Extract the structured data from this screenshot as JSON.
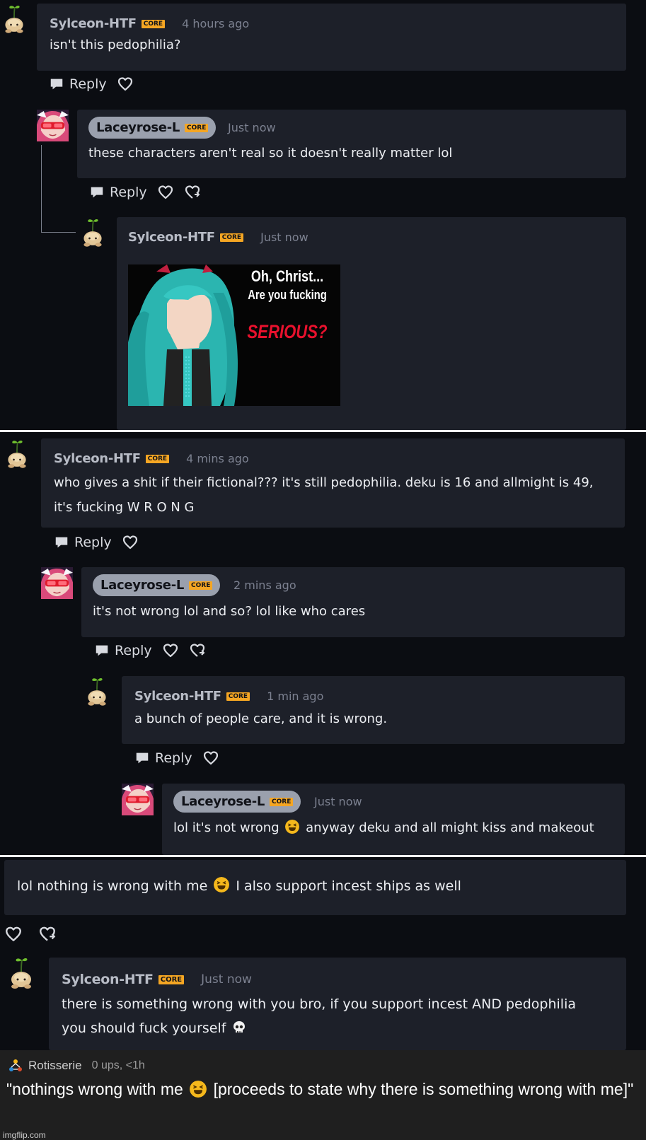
{
  "colors": {
    "bg": "#0b0d12",
    "bubble": "#1d2029",
    "core_badge": "#f5a623",
    "pill": "#9aa0ad"
  },
  "panel1": {
    "c1": {
      "user": "Sylceon-HTF",
      "badge": "CORE",
      "time": "4 hours ago",
      "text": "isn't this pedophilia?",
      "reply": "Reply"
    },
    "c2": {
      "user": "Laceyrose-L",
      "badge": "CORE",
      "time": "Just now",
      "text": "these characters aren't real so it doesn't really matter lol",
      "reply": "Reply"
    },
    "c3": {
      "user": "Sylceon-HTF",
      "badge": "CORE",
      "time": "Just now"
    },
    "meme": {
      "line1": "Oh, Christ...",
      "line2": "Are you fucking",
      "line3": "SERIOUS?"
    }
  },
  "panel2": {
    "c1": {
      "user": "Sylceon-HTF",
      "badge": "CORE",
      "time": "4 mins ago",
      "text1": "who gives a shit if their fictional??? it's still pedophilia. deku is 16 and allmight is 49,",
      "text2": "it's fucking W R O N G",
      "reply": "Reply"
    },
    "c2": {
      "user": "Laceyrose-L",
      "badge": "CORE",
      "time": "2 mins ago",
      "text": "it's not wrong lol and so? lol like who cares",
      "reply": "Reply"
    },
    "c3": {
      "user": "Sylceon-HTF",
      "badge": "CORE",
      "time": "1 min ago",
      "text": "a bunch of people care, and it is wrong.",
      "reply": "Reply"
    },
    "c4": {
      "user": "Laceyrose-L",
      "badge": "CORE",
      "time": "Just now",
      "text_a": "lol it's not wrong",
      "text_b": "anyway deku and all might kiss and makeout"
    }
  },
  "panel3": {
    "c1": {
      "text_a": "lol nothing is wrong with me",
      "text_b": "I also support incest ships as well"
    },
    "c2": {
      "user": "Sylceon-HTF",
      "badge": "CORE",
      "time": "Just now",
      "text1": "there is something wrong with you bro, if you support incest AND pedophilia",
      "text2": "you should fuck yourself"
    }
  },
  "imgflip": {
    "user": "Rotisserie",
    "meta": "0 ups, <1h",
    "text_a": "\"nothings wrong with me",
    "text_b": "[proceeds to state why there is something wrong with me]\"",
    "watermark": "imgflip.com"
  },
  "icons": {
    "reply": "speech-bubble-icon",
    "like": "heart-icon",
    "share": "heart-arrow-icon",
    "emoji": "squinting-laugh-emoji",
    "skull": "skull-emoji"
  }
}
